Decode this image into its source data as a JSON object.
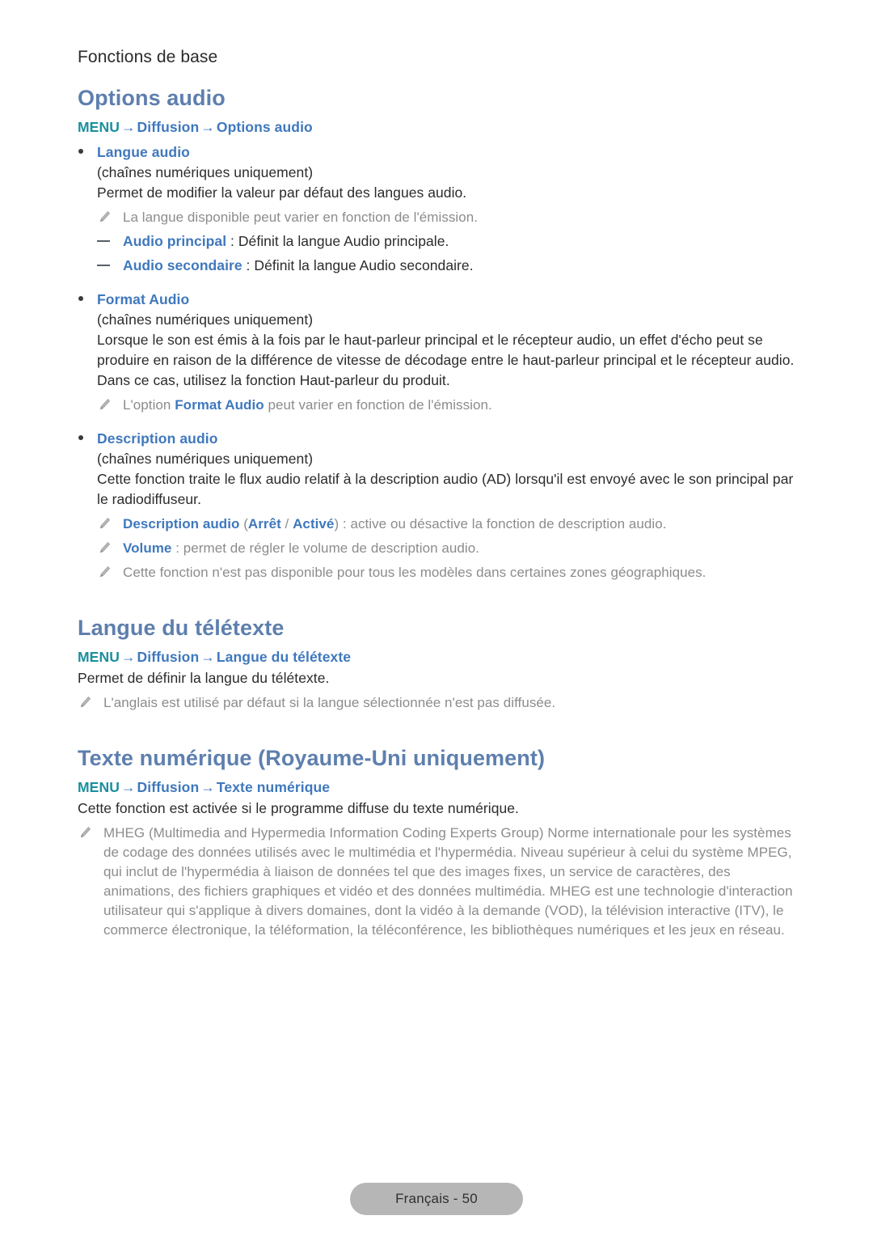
{
  "document": {
    "running_header": "Fonctions de base",
    "footer_label": "Français - 50"
  },
  "colors": {
    "heading": "#5e7fae",
    "link_blue": "#3f78bd",
    "menu_teal": "#1b8f9e",
    "note_grey": "#8c8c8c",
    "body": "#2b2b2b",
    "footer_pill_bg": "#b6b6b6"
  },
  "sections": [
    {
      "title": "Options audio",
      "breadcrumb": {
        "menu": "MENU",
        "arrow": "→",
        "level1": "Diffusion",
        "level2": "Options audio"
      },
      "items": [
        {
          "label": "Langue audio",
          "qualifier": "(chaînes numériques uniquement)",
          "body": "Permet de modifier la valeur par défaut des langues audio.",
          "notes": [
            "La langue disponible peut varier en fonction de l'émission."
          ],
          "dashes": [
            {
              "term": "Audio principal",
              "rest": " : Définit la langue Audio principale."
            },
            {
              "term": "Audio secondaire",
              "rest": " : Définit la langue Audio secondaire."
            }
          ]
        },
        {
          "label": "Format Audio",
          "qualifier": "(chaînes numériques uniquement)",
          "body": "Lorsque le son est émis à la fois par le haut-parleur principal et le récepteur audio, un effet d'écho peut se produire en raison de la différence de vitesse de décodage entre le haut-parleur principal et le récepteur audio. Dans ce cas, utilisez la fonction Haut-parleur du produit.",
          "note_rich": {
            "pre": "L'option ",
            "hl": "Format Audio",
            "post": " peut varier en fonction de l'émission."
          }
        },
        {
          "label": "Description audio",
          "qualifier": "(chaînes numériques uniquement)",
          "body": "Cette fonction traite le flux audio relatif à la description audio (AD) lorsqu'il est envoyé avec le son principal par le radiodiffuseur.",
          "note_items": [
            {
              "hl": "Description audio",
              "mid": " (",
              "hl2": "Arrêt",
              "sep": " / ",
              "hl3": "Activé",
              "post": ") : active ou désactive la fonction de description audio."
            },
            {
              "hl": "Volume",
              "post": " : permet de régler le volume de description audio."
            }
          ],
          "plain_notes": [
            "Cette fonction n'est pas disponible pour tous les modèles dans certaines zones géographiques."
          ]
        }
      ]
    },
    {
      "title": "Langue du télétexte",
      "breadcrumb": {
        "menu": "MENU",
        "arrow": "→",
        "level1": "Diffusion",
        "level2": "Langue du télétexte"
      },
      "body": "Permet de définir la langue du télétexte.",
      "notes": [
        "L'anglais est utilisé par défaut si la langue sélectionnée n'est pas diffusée."
      ]
    },
    {
      "title": "Texte numérique (Royaume-Uni uniquement)",
      "breadcrumb": {
        "menu": "MENU",
        "arrow": "→",
        "level1": "Diffusion",
        "level2": "Texte numérique"
      },
      "body": "Cette fonction est activée si le programme diffuse du texte numérique.",
      "notes": [
        "MHEG (Multimedia and Hypermedia Information Coding Experts Group) Norme internationale pour les systèmes de codage des données utilisés avec le multimédia et l'hypermédia. Niveau supérieur à celui du système MPEG, qui inclut de l'hypermédia à liaison de données tel que des images fixes, un service de caractères, des animations, des fichiers graphiques et vidéo et des données multimédia. MHEG est une technologie d'interaction utilisateur qui s'applique à divers domaines, dont la vidéo à la demande (VOD), la télévision interactive (ITV), le commerce électronique, la téléformation, la téléconférence, les bibliothèques numériques et les jeux en réseau."
      ]
    }
  ]
}
